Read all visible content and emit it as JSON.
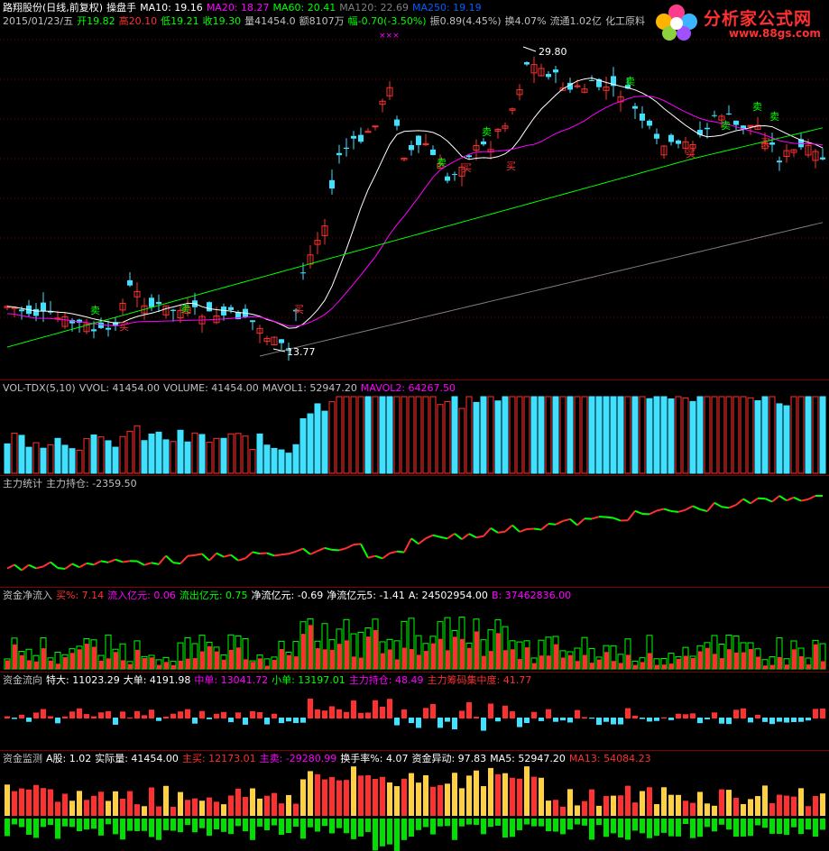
{
  "header": {
    "line1": [
      {
        "text": "路翔股份(日线,前复权)",
        "color": "#ffffff"
      },
      {
        "text": "操盘手",
        "color": "#ffffff"
      },
      {
        "text": "MA10: 19.16",
        "color": "#ffffff"
      },
      {
        "text": "MA20: 18.27",
        "color": "#ff00ff"
      },
      {
        "text": "MA60: 20.41",
        "color": "#00ff00"
      },
      {
        "text": "MA120: 22.69",
        "color": "#808080"
      },
      {
        "text": "MA250: 19.19",
        "color": "#0060ff"
      }
    ],
    "line2": [
      {
        "text": "2015/01/23/五",
        "color": "#c0c0c0"
      },
      {
        "text": "开19.82",
        "color": "#00ff00"
      },
      {
        "text": "高20.10",
        "color": "#ff3030"
      },
      {
        "text": "低19.21",
        "color": "#00ff00"
      },
      {
        "text": "收19.30",
        "color": "#00ff00"
      },
      {
        "text": "量41454.0",
        "color": "#c0c0c0"
      },
      {
        "text": "额8107万",
        "color": "#c0c0c0"
      },
      {
        "text": "幅-0.70(-3.50%)",
        "color": "#00ff00"
      },
      {
        "text": "振0.89(4.45%)",
        "color": "#c0c0c0"
      },
      {
        "text": "换4.07%",
        "color": "#c0c0c0"
      },
      {
        "text": "流通1.02亿",
        "color": "#c0c0c0"
      },
      {
        "text": "化工原料",
        "color": "#c0c0c0"
      }
    ]
  },
  "logo": {
    "title": "分析家公式网",
    "url": "www.88gs.com"
  },
  "price_chart": {
    "high_label": "29.80",
    "low_label": "13.77",
    "markers": [
      {
        "text": "卖",
        "color": "#00ff00"
      },
      {
        "text": "卖",
        "color": "#00ff00"
      },
      {
        "text": "买",
        "color": "#ff3030"
      },
      {
        "text": "买",
        "color": "#ff3030"
      },
      {
        "text": "卖",
        "color": "#00ff00"
      },
      {
        "text": "卖",
        "color": "#00ff00"
      },
      {
        "text": "买",
        "color": "#ff3030"
      },
      {
        "text": "买",
        "color": "#ff3030"
      },
      {
        "text": "卖",
        "color": "#00ff00"
      },
      {
        "text": "卖",
        "color": "#00ff00"
      },
      {
        "text": "卖",
        "color": "#00ff00"
      },
      {
        "text": "卖",
        "color": "#00ff00"
      },
      {
        "text": "买",
        "color": "#ff3030"
      },
      {
        "text": "买",
        "color": "#ff3030"
      }
    ],
    "x_marks": "×××"
  },
  "panels": {
    "vol": [
      {
        "text": "VOL-TDX(5,10)",
        "color": "#c0c0c0"
      },
      {
        "text": "VVOL: 41454.00",
        "color": "#c0c0c0"
      },
      {
        "text": "VOLUME: 41454.00",
        "color": "#c0c0c0"
      },
      {
        "text": "MAVOL1: 52947.20",
        "color": "#c0c0c0"
      },
      {
        "text": "MAVOL2: 64267.50",
        "color": "#ff00ff"
      }
    ],
    "main": [
      {
        "text": "主力统计",
        "color": "#c0c0c0"
      },
      {
        "text": "主力持仓: -2359.50",
        "color": "#c0c0c0"
      }
    ],
    "flow": [
      {
        "text": "资金净流入",
        "color": "#c0c0c0"
      },
      {
        "text": "买%: 7.14",
        "color": "#ff3030"
      },
      {
        "text": "流入亿元: 0.06",
        "color": "#ff00ff"
      },
      {
        "text": "流出亿元: 0.75",
        "color": "#00ff00"
      },
      {
        "text": "净流亿元: -0.69",
        "color": "#ffffff"
      },
      {
        "text": "净流亿元5: -1.41",
        "color": "#ffffff"
      },
      {
        "text": "A: 24502954.00",
        "color": "#ffffff"
      },
      {
        "text": "B: 37462836.00",
        "color": "#ff00ff"
      }
    ],
    "direction": [
      {
        "text": "资金流向",
        "color": "#c0c0c0"
      },
      {
        "text": "特大: 11023.29",
        "color": "#ffffff"
      },
      {
        "text": "大单: 4191.98",
        "color": "#ffffff"
      },
      {
        "text": "中单: 13041.72",
        "color": "#ff00ff"
      },
      {
        "text": "小单: 13197.01",
        "color": "#00ff00"
      },
      {
        "text": "主力持仓: 48.49",
        "color": "#ff00ff"
      },
      {
        "text": "主力筹码集中度: 41.77",
        "color": "#ff3030"
      }
    ],
    "monitor": [
      {
        "text": "资金监测",
        "color": "#c0c0c0"
      },
      {
        "text": "A股: 1.02",
        "color": "#ffffff"
      },
      {
        "text": "实际量: 41454.00",
        "color": "#ffffff"
      },
      {
        "text": "主买: 12173.01",
        "color": "#ff3030"
      },
      {
        "text": "主卖: -29280.99",
        "color": "#ff00ff"
      },
      {
        "text": "换手率%: 4.07",
        "color": "#ffffff"
      },
      {
        "text": "资金异动: 97.83",
        "color": "#ffffff"
      },
      {
        "text": "MA5: 52947.20",
        "color": "#ffffff"
      },
      {
        "text": "MA13: 54084.23",
        "color": "#ff3030"
      }
    ]
  },
  "colors": {
    "up": "#ff3030",
    "down": "#40e0ff",
    "ma10": "#ffffff",
    "ma20": "#ff00ff",
    "ma60": "#00ff00",
    "ma120": "#808080"
  }
}
